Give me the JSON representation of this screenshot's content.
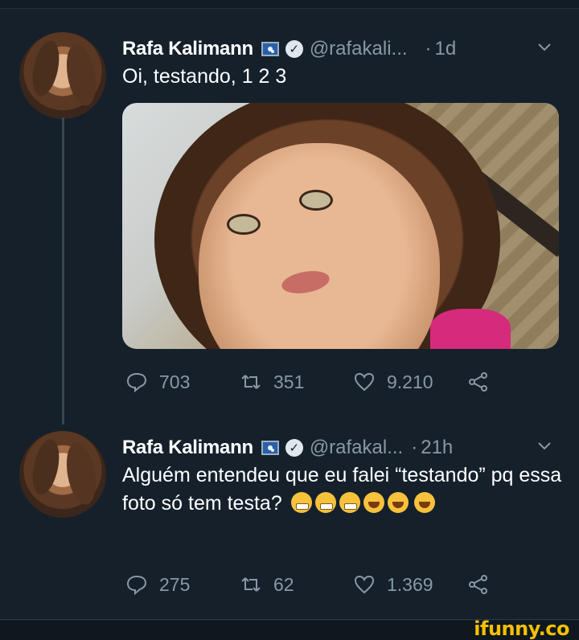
{
  "tweets": [
    {
      "name": "Rafa Kalimann",
      "handle": "@rafakali...",
      "separator": "·",
      "time": "1d",
      "text": "Oi, testando, 1 2 3",
      "replies": "703",
      "retweets": "351",
      "likes": "9.210"
    },
    {
      "name": "Rafa Kalimann",
      "handle": "@rafakal...",
      "separator": "·",
      "time": "21h",
      "text": "Alguém entendeu que eu falei “testando” pq essa foto só tem testa?",
      "replies": "275",
      "retweets": "62",
      "likes": "1.369"
    }
  ],
  "icons": {
    "reply": "reply-icon",
    "retweet": "retweet-icon",
    "like": "heart-icon",
    "share": "share-icon",
    "menu": "chevron-down-icon",
    "verified": "verified-badge-icon",
    "flag": "flag-icon"
  },
  "colors": {
    "background": "#15202b",
    "muted": "#8899a6",
    "brand": "#f4c000"
  },
  "watermark": "ifunny.co"
}
